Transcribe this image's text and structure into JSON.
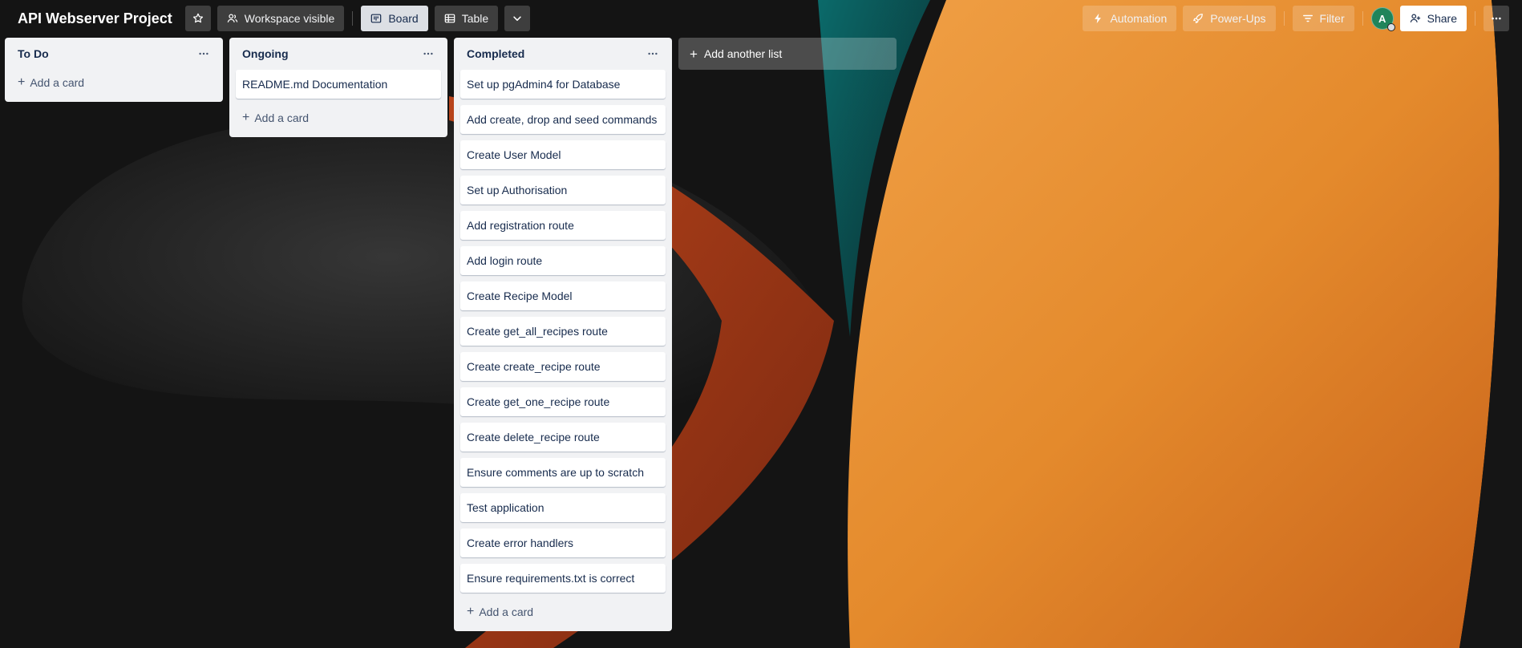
{
  "header": {
    "board_title": "API Webserver Project",
    "workspace_visible": "Workspace visible",
    "view_board": "Board",
    "view_table": "Table",
    "automation": "Automation",
    "power_ups": "Power-Ups",
    "filter": "Filter",
    "avatar_initial": "A",
    "share": "Share"
  },
  "lists": [
    {
      "title": "To Do",
      "cards": [],
      "add_label": "Add a card"
    },
    {
      "title": "Ongoing",
      "cards": [
        "README.md Documentation"
      ],
      "add_label": "Add a card"
    },
    {
      "title": "Completed",
      "cards": [
        "Set up pgAdmin4 for Database",
        "Add create, drop and seed commands",
        "Create User Model",
        "Set up Authorisation",
        "Add registration route",
        "Add login route",
        "Create Recipe Model",
        "Create get_all_recipes route",
        "Create create_recipe route",
        "Create get_one_recipe route",
        "Create delete_recipe route",
        "Ensure comments are up to scratch",
        "Test application",
        "Create error handlers",
        "Ensure requirements.txt is correct"
      ],
      "add_label": "Add a card"
    }
  ],
  "add_list_label": "Add another list",
  "colors": {
    "background": "#141414",
    "accent_orange": "#e48a2c",
    "accent_teal": "#0f4a4c",
    "list_bg": "#f1f2f4",
    "avatar": "#1f845a"
  }
}
